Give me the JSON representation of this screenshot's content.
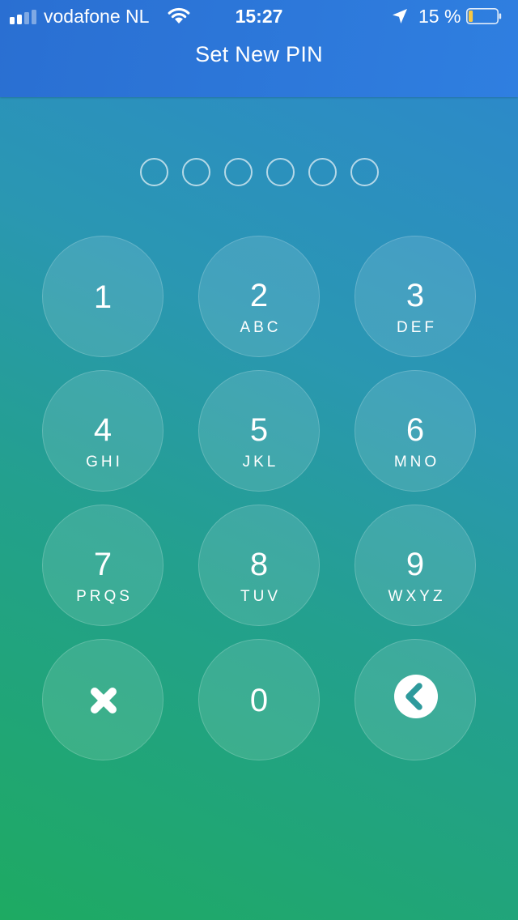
{
  "status_bar": {
    "carrier": "vodafone NL",
    "time": "15:27",
    "battery_percent": "15 %",
    "battery_level": 0.15,
    "signal_bars_active": 2,
    "signal_bars_total": 4
  },
  "header": {
    "title": "Set New PIN"
  },
  "pin": {
    "length": 6,
    "entered": 0
  },
  "keypad": {
    "keys": [
      {
        "digit": "1",
        "letters": ""
      },
      {
        "digit": "2",
        "letters": "ABC"
      },
      {
        "digit": "3",
        "letters": "DEF"
      },
      {
        "digit": "4",
        "letters": "GHI"
      },
      {
        "digit": "5",
        "letters": "JKL"
      },
      {
        "digit": "6",
        "letters": "MNO"
      },
      {
        "digit": "7",
        "letters": "PRQS"
      },
      {
        "digit": "8",
        "letters": "TUV"
      },
      {
        "digit": "9",
        "letters": "WXYZ"
      },
      {
        "digit": "0",
        "letters": ""
      }
    ],
    "cancel_icon": "close-icon",
    "back_icon": "back-circle-icon"
  },
  "colors": {
    "header_bg": "#2f7fe0",
    "battery_fill": "#f7c844",
    "white": "#ffffff"
  }
}
